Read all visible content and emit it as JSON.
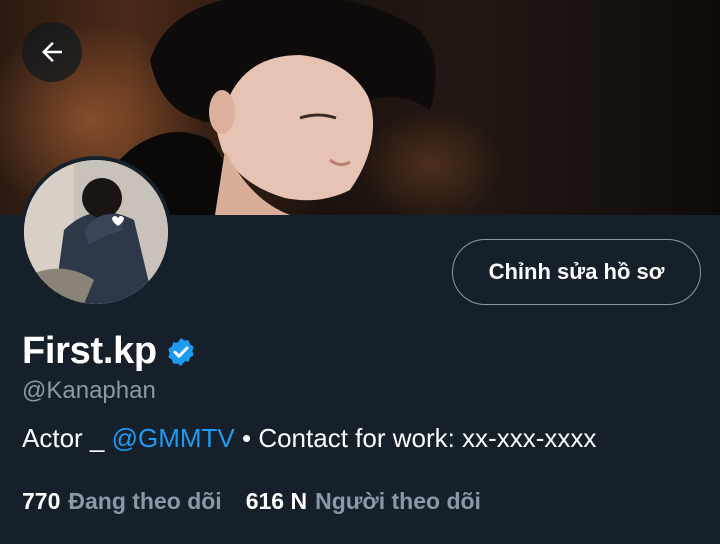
{
  "header": {
    "back_icon": "arrow-left-icon"
  },
  "profile": {
    "display_name": "First.kp",
    "verified_icon": "verified-badge-icon",
    "handle": "@Kanaphan",
    "edit_button_label": "Chỉnh sửa hồ sơ",
    "bio": {
      "prefix": "Actor _ ",
      "mention": "@GMMTV",
      "suffix": " • Contact for work: xx-xxx-xxxx"
    },
    "stats": {
      "following_count": "770",
      "following_label": "Đang theo dõi",
      "followers_count": "616 N",
      "followers_label": "Người theo dõi"
    }
  },
  "colors": {
    "background": "#15202b",
    "accent": "#1d9bf0",
    "secondary_text": "#8b98a5"
  }
}
